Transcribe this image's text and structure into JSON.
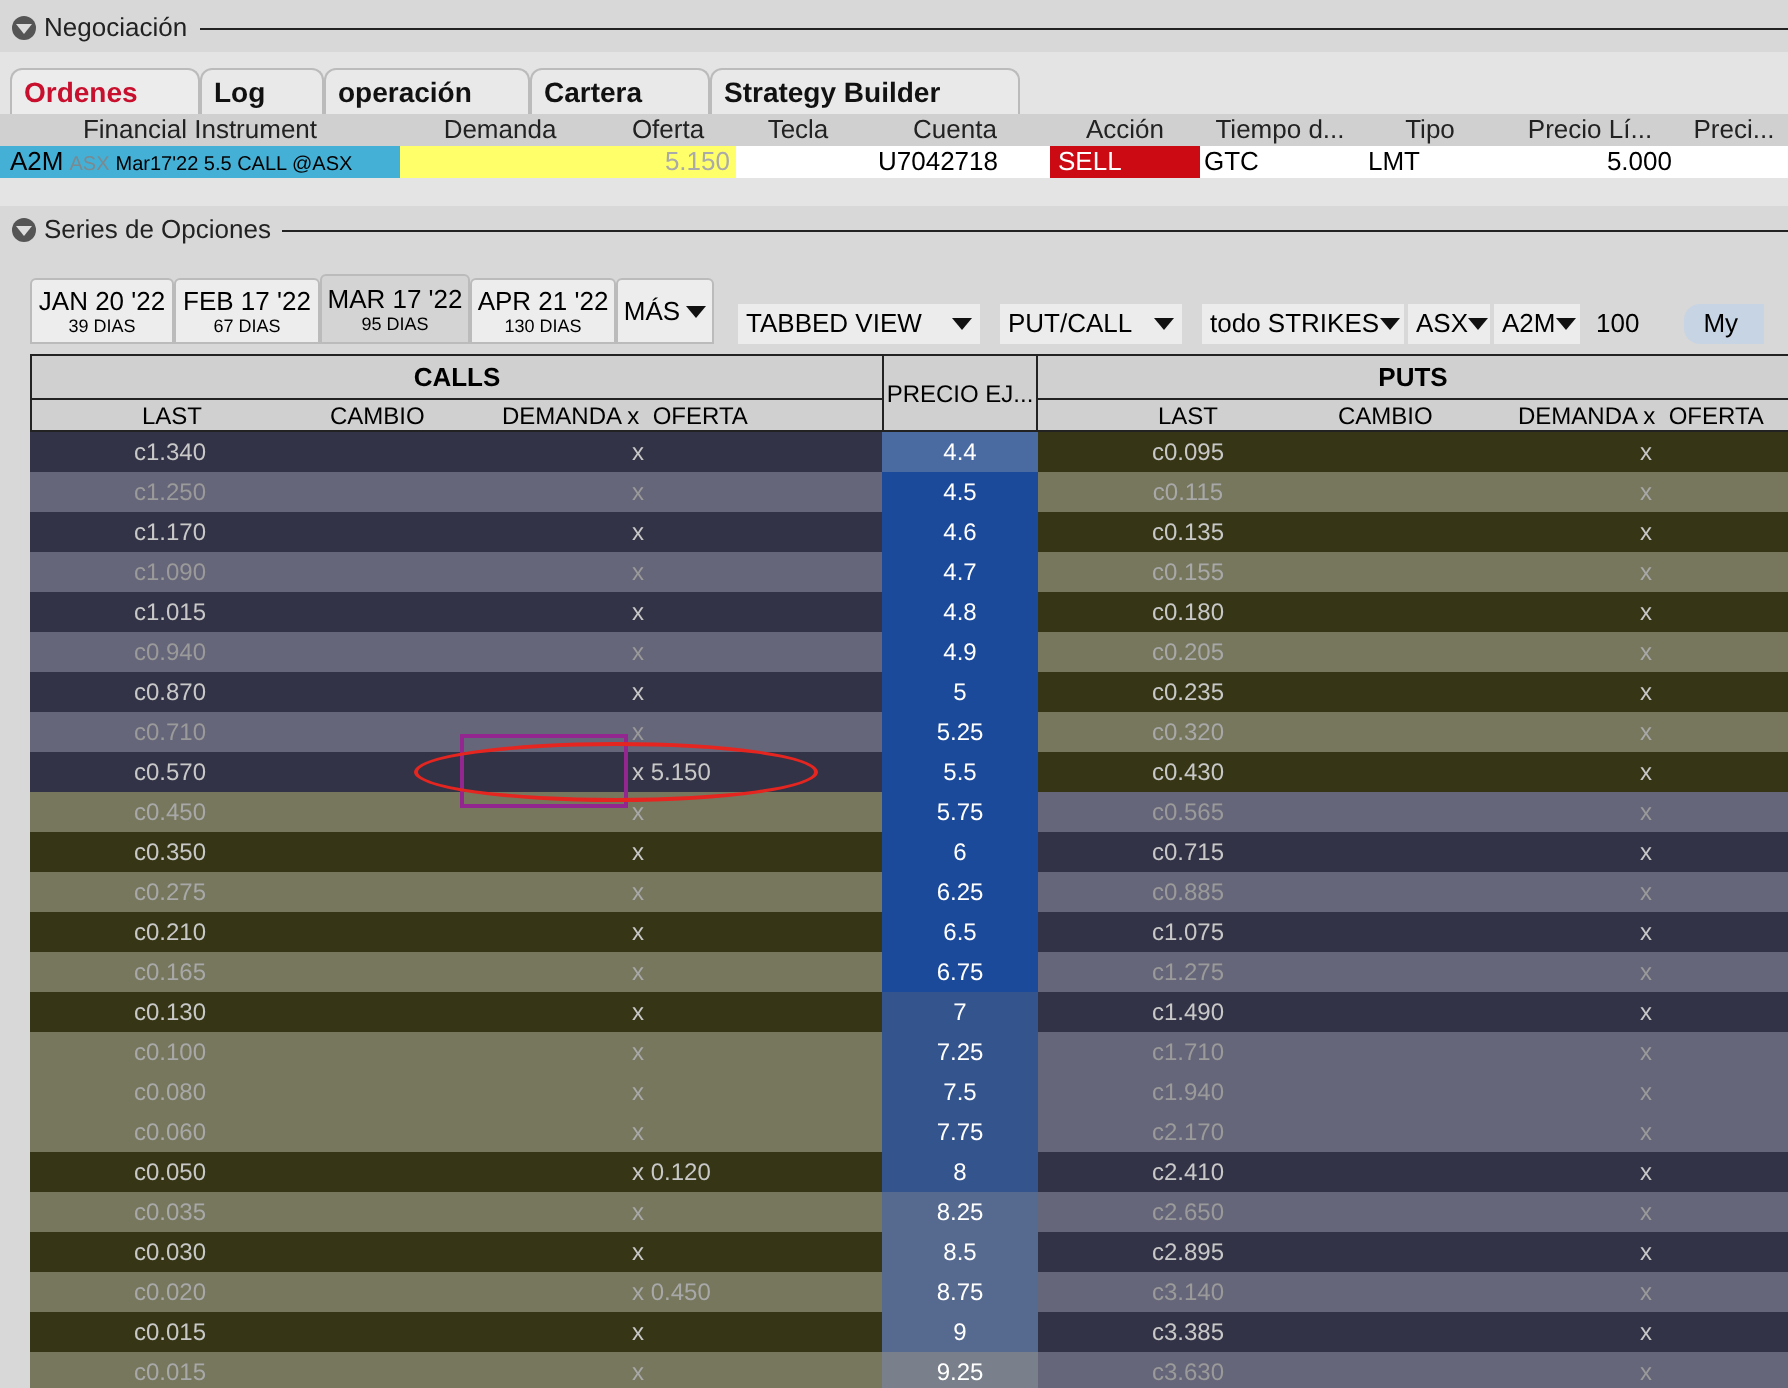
{
  "trading_section": {
    "title": "Negociación"
  },
  "tabs": [
    {
      "label": "Ordenes",
      "selected": true
    },
    {
      "label": "Log",
      "selected": false
    },
    {
      "label": "operación",
      "selected": false
    },
    {
      "label": "Cartera",
      "selected": false
    },
    {
      "label": "Strategy Builder",
      "selected": false
    }
  ],
  "order_table": {
    "columns": [
      "Financial Instrument",
      "Demanda",
      "Oferta",
      "Tecla",
      "Cuenta",
      "Acción",
      "Tiempo d...",
      "Tipo",
      "Precio Lí...",
      "Preci..."
    ],
    "row": {
      "symbol": "A2M",
      "exchange": "ASX",
      "contract": "Mar17'22 5.5 CALL @ASX",
      "ask": "5.150",
      "account": "U7042718",
      "action": "SELL",
      "time_in_force": "GTC",
      "type": "LMT",
      "limit_price": "5.000"
    }
  },
  "option_section": {
    "title": "Series de Opciones"
  },
  "expiries": [
    {
      "date": "JAN 20 '22",
      "days": "39 DIAS",
      "selected": false
    },
    {
      "date": "FEB 17 '22",
      "days": "67 DIAS",
      "selected": false
    },
    {
      "date": "MAR 17 '22",
      "days": "95 DIAS",
      "selected": true
    },
    {
      "date": "APR 21 '22",
      "days": "130 DIAS",
      "selected": false
    }
  ],
  "more_button": "MÁS",
  "toolbar": {
    "dropdowns": [
      "TABBED VIEW",
      "PUT/CALL",
      "todo STRIKES",
      "ASX",
      "A2M"
    ],
    "multiplier": "100",
    "button": "My"
  },
  "chain": {
    "calls_title": "CALLS",
    "puts_title": "PUTS",
    "strike_header": "PRECIO EJ...",
    "call_columns": [
      "LAST",
      "CAMBIO",
      "DEMANDA x  OFERTA"
    ],
    "put_columns": [
      "LAST",
      "CAMBIO",
      "DEMANDA x  OFERTA"
    ],
    "rows": [
      {
        "strike": "4.4",
        "color": "#4a6aa2",
        "call": {
          "last": "c1.340",
          "quote": "x",
          "in_the_money": true,
          "dark": true,
          "circled": false
        },
        "put": {
          "last": "c0.095",
          "quote": "x",
          "in_the_money": false,
          "dark": true
        }
      },
      {
        "strike": "4.5",
        "color": "#1c4a9a",
        "call": {
          "last": "c1.250",
          "quote": "x",
          "in_the_money": true,
          "dark": false,
          "circled": false
        },
        "put": {
          "last": "c0.115",
          "quote": "x",
          "in_the_money": false,
          "dark": false
        }
      },
      {
        "strike": "4.6",
        "color": "#1c4a9a",
        "call": {
          "last": "c1.170",
          "quote": "x",
          "in_the_money": true,
          "dark": true,
          "circled": false
        },
        "put": {
          "last": "c0.135",
          "quote": "x",
          "in_the_money": false,
          "dark": true
        }
      },
      {
        "strike": "4.7",
        "color": "#1c4a9a",
        "call": {
          "last": "c1.090",
          "quote": "x",
          "in_the_money": true,
          "dark": false,
          "circled": false
        },
        "put": {
          "last": "c0.155",
          "quote": "x",
          "in_the_money": false,
          "dark": false
        }
      },
      {
        "strike": "4.8",
        "color": "#1c4a9a",
        "call": {
          "last": "c1.015",
          "quote": "x",
          "in_the_money": true,
          "dark": true,
          "circled": false
        },
        "put": {
          "last": "c0.180",
          "quote": "x",
          "in_the_money": false,
          "dark": true
        }
      },
      {
        "strike": "4.9",
        "color": "#1c4a9a",
        "call": {
          "last": "c0.940",
          "quote": "x",
          "in_the_money": true,
          "dark": false,
          "circled": false
        },
        "put": {
          "last": "c0.205",
          "quote": "x",
          "in_the_money": false,
          "dark": false
        }
      },
      {
        "strike": "5",
        "color": "#1c4a9a",
        "call": {
          "last": "c0.870",
          "quote": "x",
          "in_the_money": true,
          "dark": true,
          "circled": false
        },
        "put": {
          "last": "c0.235",
          "quote": "x",
          "in_the_money": false,
          "dark": true
        }
      },
      {
        "strike": "5.25",
        "color": "#1c4a9a",
        "call": {
          "last": "c0.710",
          "quote": "x",
          "in_the_money": true,
          "dark": false,
          "circled": false
        },
        "put": {
          "last": "c0.320",
          "quote": "x",
          "in_the_money": false,
          "dark": false
        }
      },
      {
        "strike": "5.5",
        "color": "#1c4a9a",
        "call": {
          "last": "c0.570",
          "quote": "x 5.150",
          "in_the_money": true,
          "dark": true,
          "circled": true
        },
        "put": {
          "last": "c0.430",
          "quote": "x",
          "in_the_money": false,
          "dark": true
        }
      },
      {
        "strike": "5.75",
        "color": "#1c4a9a",
        "call": {
          "last": "c0.450",
          "quote": "x",
          "in_the_money": false,
          "dark": false,
          "circled": false
        },
        "put": {
          "last": "c0.565",
          "quote": "x",
          "in_the_money": true,
          "dark": false
        }
      },
      {
        "strike": "6",
        "color": "#1c4a9a",
        "call": {
          "last": "c0.350",
          "quote": "x",
          "in_the_money": false,
          "dark": true,
          "circled": false
        },
        "put": {
          "last": "c0.715",
          "quote": "x",
          "in_the_money": true,
          "dark": true
        }
      },
      {
        "strike": "6.25",
        "color": "#1c4a9a",
        "call": {
          "last": "c0.275",
          "quote": "x",
          "in_the_money": false,
          "dark": false,
          "circled": false
        },
        "put": {
          "last": "c0.885",
          "quote": "x",
          "in_the_money": true,
          "dark": false
        }
      },
      {
        "strike": "6.5",
        "color": "#1c4a9a",
        "call": {
          "last": "c0.210",
          "quote": "x",
          "in_the_money": false,
          "dark": true,
          "circled": false
        },
        "put": {
          "last": "c1.075",
          "quote": "x",
          "in_the_money": true,
          "dark": true
        }
      },
      {
        "strike": "6.75",
        "color": "#1c4a9a",
        "call": {
          "last": "c0.165",
          "quote": "x",
          "in_the_money": false,
          "dark": false,
          "circled": false
        },
        "put": {
          "last": "c1.275",
          "quote": "x",
          "in_the_money": true,
          "dark": false
        }
      },
      {
        "strike": "7",
        "color": "#34548e",
        "call": {
          "last": "c0.130",
          "quote": "x",
          "in_the_money": false,
          "dark": true,
          "circled": false
        },
        "put": {
          "last": "c1.490",
          "quote": "x",
          "in_the_money": true,
          "dark": true
        }
      },
      {
        "strike": "7.25",
        "color": "#34548e",
        "call": {
          "last": "c0.100",
          "quote": "x",
          "in_the_money": false,
          "dark": false,
          "circled": false
        },
        "put": {
          "last": "c1.710",
          "quote": "x",
          "in_the_money": true,
          "dark": false
        }
      },
      {
        "strike": "7.5",
        "color": "#34548e",
        "call": {
          "last": "c0.080",
          "quote": "x",
          "in_the_money": false,
          "dark": false,
          "circled": false
        },
        "put": {
          "last": "c1.940",
          "quote": "x",
          "in_the_money": true,
          "dark": false
        }
      },
      {
        "strike": "7.75",
        "color": "#34548e",
        "call": {
          "last": "c0.060",
          "quote": "x",
          "in_the_money": false,
          "dark": false,
          "circled": false
        },
        "put": {
          "last": "c2.170",
          "quote": "x",
          "in_the_money": true,
          "dark": false
        }
      },
      {
        "strike": "8",
        "color": "#34548e",
        "call": {
          "last": "c0.050",
          "quote": "x 0.120",
          "in_the_money": false,
          "dark": true,
          "circled": false
        },
        "put": {
          "last": "c2.410",
          "quote": "x",
          "in_the_money": true,
          "dark": true
        }
      },
      {
        "strike": "8.25",
        "color": "#56698f",
        "call": {
          "last": "c0.035",
          "quote": "x",
          "in_the_money": false,
          "dark": false,
          "circled": false
        },
        "put": {
          "last": "c2.650",
          "quote": "x",
          "in_the_money": true,
          "dark": false
        }
      },
      {
        "strike": "8.5",
        "color": "#56698f",
        "call": {
          "last": "c0.030",
          "quote": "x",
          "in_the_money": false,
          "dark": true,
          "circled": false
        },
        "put": {
          "last": "c2.895",
          "quote": "x",
          "in_the_money": true,
          "dark": true
        }
      },
      {
        "strike": "8.75",
        "color": "#56698f",
        "call": {
          "last": "c0.020",
          "quote": "x 0.450",
          "in_the_money": false,
          "dark": false,
          "circled": false
        },
        "put": {
          "last": "c3.140",
          "quote": "x",
          "in_the_money": true,
          "dark": false
        }
      },
      {
        "strike": "9",
        "color": "#56698f",
        "call": {
          "last": "c0.015",
          "quote": "x",
          "in_the_money": false,
          "dark": true,
          "circled": false
        },
        "put": {
          "last": "c3.385",
          "quote": "x",
          "in_the_money": true,
          "dark": true
        }
      },
      {
        "strike": "9.25",
        "color": "#79808b",
        "call": {
          "last": "c0.015",
          "quote": "x",
          "in_the_money": false,
          "dark": false,
          "circled": false
        },
        "put": {
          "last": "c3.630",
          "quote": "x",
          "in_the_money": true,
          "dark": false
        }
      }
    ]
  }
}
